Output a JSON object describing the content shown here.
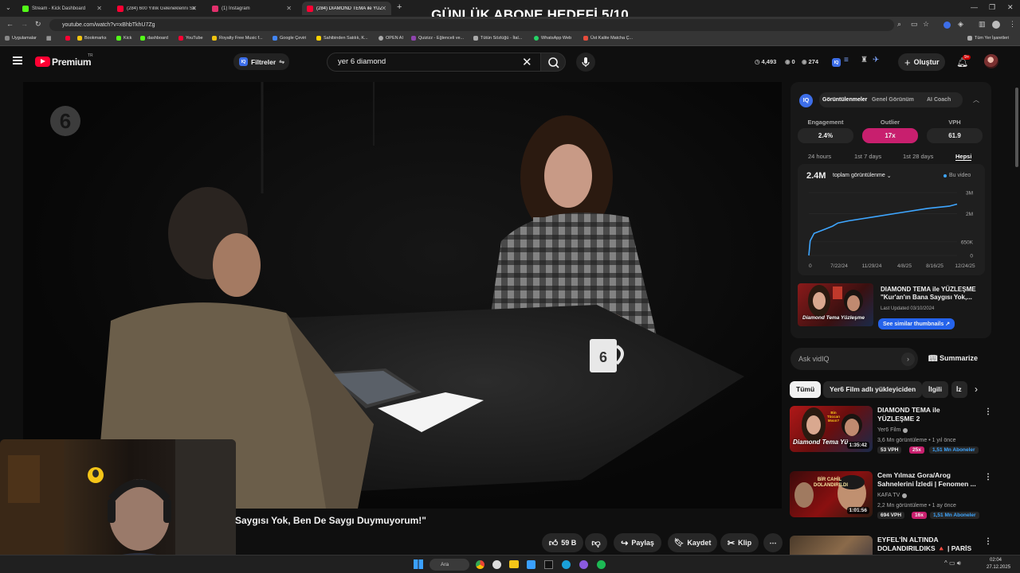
{
  "overlay_title": "GÜNLÜK ABONE HEDEFİ 5/10",
  "tabs": [
    {
      "label": "Stream - Kick Dashboard",
      "color": "#53fc18",
      "active": false
    },
    {
      "label": "(284) 600 Yıllık Geleneklerini Sorgu...",
      "color": "#ff0033",
      "active": false
    },
    {
      "label": "(1) Instagram",
      "color": "#e1306c",
      "active": false
    },
    {
      "label": "(284) DIAMOND TEMA ile YÜZLEŞ...",
      "color": "#ff0033",
      "active": true
    }
  ],
  "new_tab_icon": "+",
  "url": "youtube.com/watch?v=xBhbTkhU7Zg",
  "bookmarks": [
    {
      "label": "Uygulamalar",
      "color": "#888"
    },
    {
      "label": "Bookmarks",
      "color": "#f1c40f"
    },
    {
      "label": "Kick",
      "color": "#53fc18"
    },
    {
      "label": "dashboard",
      "color": "#53fc18"
    },
    {
      "label": "YouTube",
      "color": "#ff0033"
    },
    {
      "label": "Royalty Free Music f...",
      "color": "#f1c40f"
    },
    {
      "label": "Google Çeviri",
      "color": "#4285f4"
    },
    {
      "label": "Sahibinden Satılık, K...",
      "color": "#ffd200"
    },
    {
      "label": "OPEN AI",
      "color": "#aaaaaa"
    },
    {
      "label": "Quizizz - Eğlenceli ve...",
      "color": "#8e44ad"
    },
    {
      "label": "Tütün Sözlüğü - İtal...",
      "color": "#aaaaaa"
    },
    {
      "label": "WhatsApp Web",
      "color": "#25d366"
    },
    {
      "label": "Üst Kalite Matcha Ç...",
      "color": "#e74c3c"
    }
  ],
  "bookmarks_right": "Tüm Yer İşaretleri",
  "header": {
    "brand": "Premium",
    "brand_region": "TR",
    "filters_label": "Filtreler",
    "search_value": "yer 6 diamond",
    "stat_1": "4,493",
    "stat_2": "0",
    "stat_3": "274",
    "create_label": "Oluştur",
    "notif_count": "9+"
  },
  "video": {
    "title": "Saygısı Yok, Ben De Saygı Duymuyorum!\"",
    "watermark": "6",
    "likes": "59 B",
    "share": "Paylaş",
    "save": "Kaydet",
    "clip": "Klip"
  },
  "vidiq": {
    "iq_label": "IQ",
    "tabs": [
      "Görüntülenmeler",
      "Genel Görünüm",
      "AI Coach"
    ],
    "metrics": [
      {
        "label": "Engagement",
        "value": "2.4%"
      },
      {
        "label": "Outlier",
        "value": "17x"
      },
      {
        "label": "VPH",
        "value": "61.9"
      }
    ],
    "ranges": [
      "24 hours",
      "1st 7 days",
      "1st 28 days",
      "Hepsi"
    ],
    "total": "2.4M",
    "total_label": "toplam görüntülenme",
    "legend": "Bu video",
    "thumb_title": "DIAMOND TEMA ile YÜZLEŞME \"Kur'an'ın Bana Saygısı Yok,...",
    "last_updated": "Last Updated 03/10/2024",
    "similar_btn": "See similar thumbnails",
    "thumb_text": "Diamond Tema Yüzleşme"
  },
  "chart_data": {
    "type": "line",
    "title": "",
    "series": [
      {
        "name": "Bu video",
        "color": "#3ea6ff"
      }
    ],
    "x_ticks": [
      "0",
      "7/22/24",
      "11/29/24",
      "4/8/25",
      "8/16/25",
      "12/24/25"
    ],
    "y_ticks": [
      "3M",
      "2M",
      "650K",
      "0"
    ],
    "ylim": [
      0,
      3000000
    ],
    "x_days": [
      0,
      5,
      20,
      60,
      90,
      110,
      150,
      250,
      350,
      450,
      530,
      560
    ],
    "values": [
      0,
      700000,
      1050000,
      1250000,
      1400000,
      1550000,
      1650000,
      1850000,
      2050000,
      2250000,
      2350000,
      2450000
    ]
  },
  "ask": {
    "placeholder": "Ask vidIQ",
    "summarize": "Summarize"
  },
  "chips": [
    "Tümü",
    "Yer6 Film adlı yükleyiciden",
    "İlgili",
    "İz"
  ],
  "recommendations": [
    {
      "title": "DIAMOND TEMA ile YÜZLEŞME 2",
      "channel": "Yer6 Film",
      "meta": "3,6 Mn görüntüleme • 1 yıl önce",
      "duration": "1:35:42",
      "vph": "53 VPH",
      "outlier": "25x",
      "subs": "1,51 Mn Aboneler",
      "thumb_text": "Diamond Tema Yü...",
      "thumb_sub": "Bin Tüccarı Mısın?"
    },
    {
      "title": "Cem Yılmaz Gora/Arog Sahnelerini İzledi | Fenomen ...",
      "channel": "KAFA TV",
      "meta": "2,2 Mn görüntüleme • 1 ay önce",
      "duration": "1:01:56",
      "vph": "694 VPH",
      "outlier": "16x",
      "subs": "1,51 Mn Aboneler",
      "thumb_text": "BİR CAHİL DOLANDIRILDI",
      "thumb_sub": ""
    },
    {
      "title": "EYFEL'İN ALTINDA DOLANDIRILDIKS 🔺 | PARİS ...",
      "channel": "",
      "meta": "",
      "duration": "",
      "vph": "",
      "outlier": "",
      "subs": "",
      "thumb_text": "",
      "thumb_sub": ""
    }
  ],
  "taskbar": {
    "search": "Ara",
    "time": "02:04",
    "date": "27.12.2025"
  }
}
